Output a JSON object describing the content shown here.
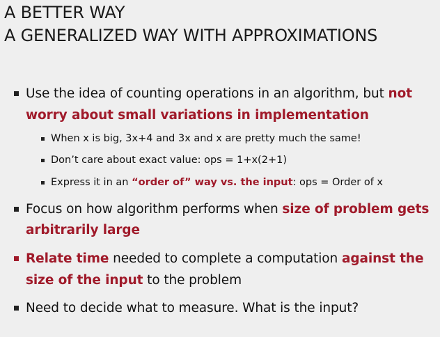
{
  "slide": {
    "title_line1": "A BETTER WAY",
    "title_line2": "A GENERALIZED WAY WITH APPROXIMATIONS",
    "bullet1": {
      "text1": "Use the idea of counting operations in an algorithm, but ",
      "hl1": "not",
      "hl2": "worry about small variations in implementation"
    },
    "sub1": {
      "text": "When x is big, 3x+4 and 3x and x are pretty much the same!"
    },
    "sub2": {
      "text": "Don’t care about exact value: ops = 1+x(2+1)"
    },
    "sub3": {
      "text1": "Express it in an ",
      "hl": "“order of” way vs. the input",
      "text2": ": ops = Order of x"
    },
    "bullet2": {
      "text1": "Focus on how algorithm performs when ",
      "hl1": "size of problem gets",
      "hl2": "arbitrarily large"
    },
    "bullet3": {
      "hl1": "Relate time",
      "text1": " needed to complete a computation ",
      "hl2": "against the",
      "hl3": "size of the input",
      "text2": " to the problem"
    },
    "bullet4": {
      "text": "Need to decide what to measure. What is the input?"
    },
    "accent_color": "#a01a2a",
    "background_color": "#efefef"
  }
}
